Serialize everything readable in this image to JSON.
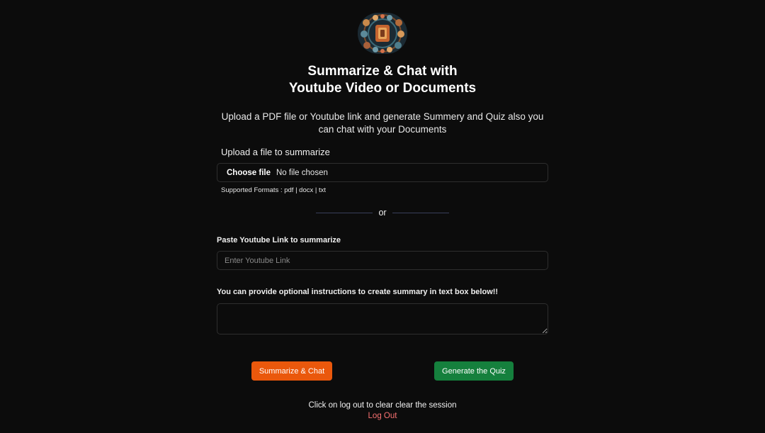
{
  "header": {
    "logo_icon": "ornate-mandala-logo",
    "title_line1": "Summarize & Chat with",
    "title_line2": "Youtube Video or Documents",
    "subtitle": "Upload a PDF file or Youtube link and generate Summery and Quiz also you can chat with your Documents"
  },
  "upload": {
    "label": "Upload a file to summarize",
    "choose_button": "Choose file",
    "status": "No file chosen",
    "formats": "Supported Formats : pdf | docx | txt"
  },
  "divider": {
    "text": "or"
  },
  "youtube": {
    "label": "Paste Youtube Link to summarize",
    "placeholder": "Enter Youtube Link",
    "value": ""
  },
  "instructions": {
    "label": "You can provide optional instructions to create summary in text box below!!",
    "value": ""
  },
  "actions": {
    "summarize_label": "Summarize & Chat",
    "quiz_label": "Generate the Quiz",
    "summarize_color": "#ea580c",
    "quiz_color": "#15803d"
  },
  "footer": {
    "text": "Click on log out to clear clear the session",
    "logout_label": "Log Out",
    "logout_color": "#f87171"
  }
}
